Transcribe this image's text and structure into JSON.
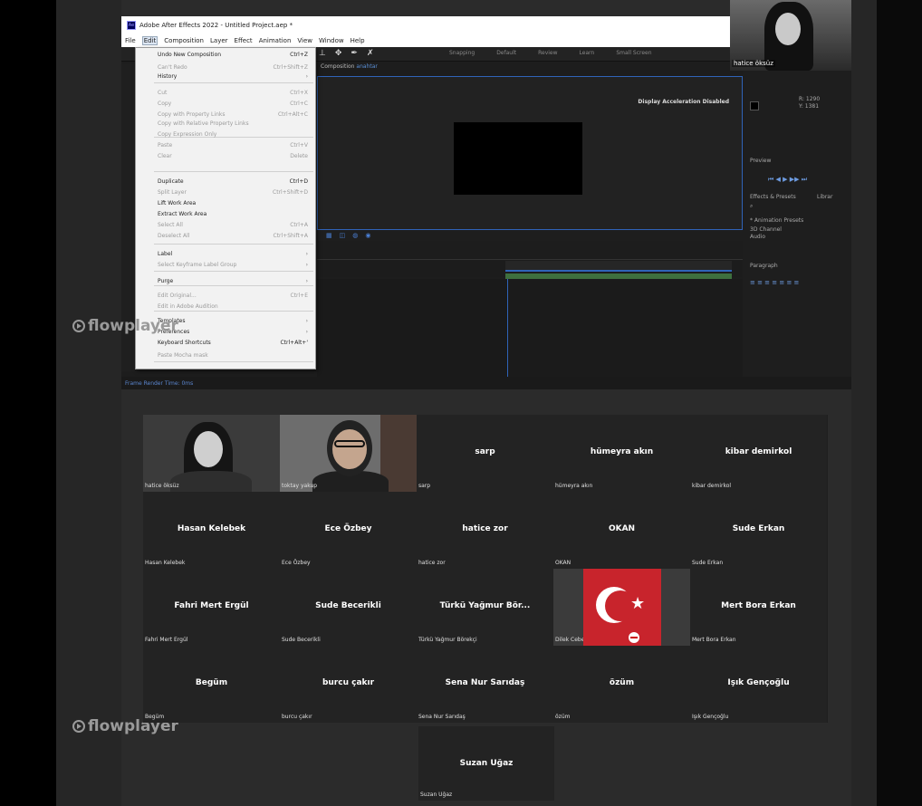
{
  "ae": {
    "window_title": "Adobe After Effects 2022 - Untitled Project.aep *",
    "menubar": [
      "File",
      "Edit",
      "Composition",
      "Layer",
      "Effect",
      "Animation",
      "View",
      "Window",
      "Help"
    ],
    "composition_tab": "Composition",
    "composition_name": "anahtar",
    "display_notice": "Display Acceleration Disabled",
    "workspaces": [
      "Snapping",
      "Default",
      "Review",
      "Learn",
      "Small Screen"
    ],
    "right_panel": {
      "preview": "Preview",
      "effects_presets": "Effects & Presets",
      "library": "Librar",
      "animation_presets": "* Animation Presets",
      "channel": "3D Channel",
      "audio": "Audio",
      "paragraph": "Paragraph",
      "info_r": "R: 1290",
      "info_g": "Y: 1381"
    },
    "statusbar": "Frame Render Time: 0ms"
  },
  "edit_menu": [
    {
      "label": "Undo New Composition",
      "shortcut": "Ctrl+Z",
      "disabled": false
    },
    {
      "label": "Can't Redo",
      "shortcut": "Ctrl+Shift+Z",
      "disabled": true
    },
    {
      "label": "History",
      "shortcut": "",
      "disabled": false,
      "submenu": true
    },
    {
      "label": "Cut",
      "shortcut": "Ctrl+X",
      "disabled": true
    },
    {
      "label": "Copy",
      "shortcut": "Ctrl+C",
      "disabled": true
    },
    {
      "label": "Copy with Property Links",
      "shortcut": "Ctrl+Alt+C",
      "disabled": true
    },
    {
      "label": "Copy with Relative Property Links",
      "shortcut": "",
      "disabled": true
    },
    {
      "label": "Copy Expression Only",
      "shortcut": "",
      "disabled": true
    },
    {
      "label": "Paste",
      "shortcut": "Ctrl+V",
      "disabled": true
    },
    {
      "label": "Clear",
      "shortcut": "Delete",
      "disabled": true
    },
    {
      "label": "Duplicate",
      "shortcut": "Ctrl+D",
      "disabled": false
    },
    {
      "label": "Split Layer",
      "shortcut": "Ctrl+Shift+D",
      "disabled": true
    },
    {
      "label": "Lift Work Area",
      "shortcut": "",
      "disabled": false
    },
    {
      "label": "Extract Work Area",
      "shortcut": "",
      "disabled": false
    },
    {
      "label": "Select All",
      "shortcut": "Ctrl+A",
      "disabled": true
    },
    {
      "label": "Deselect All",
      "shortcut": "Ctrl+Shift+A",
      "disabled": true
    },
    {
      "label": "Label",
      "shortcut": "",
      "disabled": false,
      "submenu": true
    },
    {
      "label": "Select Keyframe Label Group",
      "shortcut": "",
      "disabled": true,
      "submenu": true
    },
    {
      "label": "Purge",
      "shortcut": "",
      "disabled": false,
      "submenu": true
    },
    {
      "label": "Edit Original...",
      "shortcut": "Ctrl+E",
      "disabled": true
    },
    {
      "label": "Edit in Adobe Audition",
      "shortcut": "",
      "disabled": true
    },
    {
      "label": "Templates",
      "shortcut": "",
      "disabled": false,
      "submenu": true
    },
    {
      "label": "Preferences",
      "shortcut": "",
      "disabled": false,
      "submenu": true
    },
    {
      "label": "Keyboard Shortcuts",
      "shortcut": "Ctrl+Alt+'",
      "disabled": false
    },
    {
      "label": "Paste Mocha mask",
      "shortcut": "",
      "disabled": true
    }
  ],
  "presenter": {
    "name": "hatice öksüz"
  },
  "watermark": "flowplayer",
  "participants": [
    {
      "center": "",
      "label": "hatice öksüz",
      "video": "v1"
    },
    {
      "center": "",
      "label": "toktay yakup",
      "video": "v2"
    },
    {
      "center": "sarp",
      "label": "sarp"
    },
    {
      "center": "hümeyra akın",
      "label": "hümeyra akın"
    },
    {
      "center": "kibar demirkol",
      "label": "kibar demirkol"
    },
    {
      "center": "Hasan Kelebek",
      "label": "Hasan Kelebek"
    },
    {
      "center": "Ece Özbey",
      "label": "Ece Özbey"
    },
    {
      "center": "hatice zor",
      "label": "hatice zor"
    },
    {
      "center": "OKAN",
      "label": "OKAN"
    },
    {
      "center": "Sude Erkan",
      "label": "Sude Erkan"
    },
    {
      "center": "Fahri Mert Ergül",
      "label": "Fahri Mert Ergül"
    },
    {
      "center": "Sude Becerikli",
      "label": "Sude Becerikli"
    },
    {
      "center": "Türkü Yağmur Bör...",
      "label": "Türkü Yağmur Börekçi"
    },
    {
      "center": "",
      "label": "Dilek Cebeci",
      "video": "flag"
    },
    {
      "center": "Mert Bora Erkan",
      "label": "Mert Bora Erkan"
    },
    {
      "center": "Begüm",
      "label": "Begüm"
    },
    {
      "center": "burcu çakır",
      "label": "burcu çakır"
    },
    {
      "center": "Sena Nur Sarıdaş",
      "label": "Sena Nur Sarıdaş"
    },
    {
      "center": "özüm",
      "label": "özüm"
    },
    {
      "center": "Işık Gençoğlu",
      "label": "Işık Gençoğlu"
    }
  ],
  "last_participant": {
    "center": "Suzan Uğaz",
    "label": "Suzan Uğaz"
  }
}
